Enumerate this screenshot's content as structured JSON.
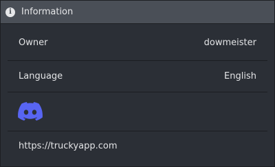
{
  "header": {
    "title": "Information",
    "icon": "info-icon"
  },
  "rows": {
    "owner": {
      "label": "Owner",
      "value": "dowmeister"
    },
    "language": {
      "label": "Language",
      "value": "English"
    },
    "discord": {
      "icon": "discord-icon",
      "color": "#5865f2"
    },
    "website": {
      "url": "https://truckyapp.com"
    }
  },
  "colors": {
    "panel_bg": "#2b2f36",
    "header_bg": "#4a4f57",
    "text": "#e3e4e6",
    "divider": "#1b1d21"
  }
}
